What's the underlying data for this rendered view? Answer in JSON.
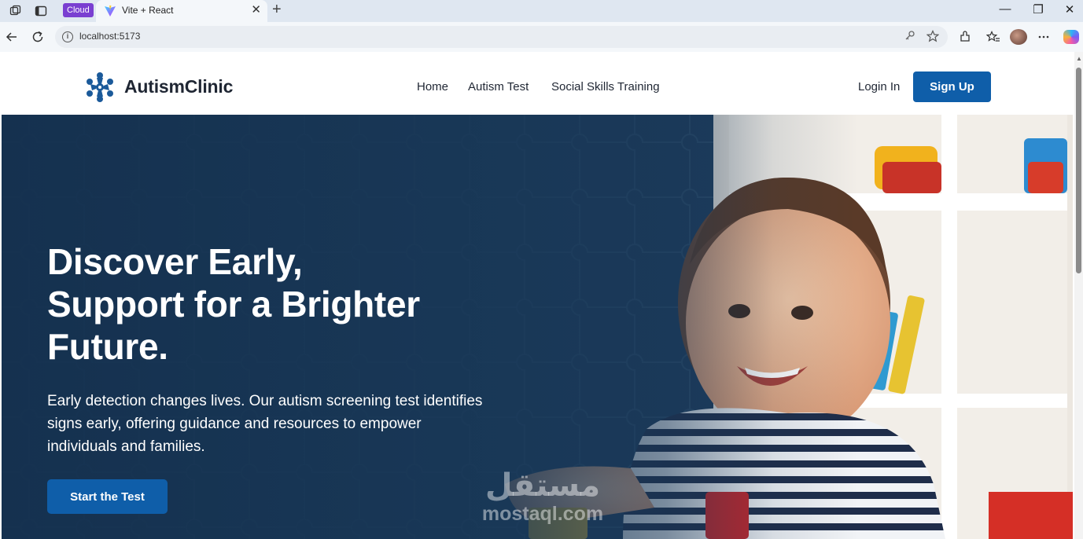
{
  "browser": {
    "badge": "Cloud",
    "tab_title": "Vite + React",
    "tab_close": "✕",
    "new_tab": "+",
    "url": "localhost:5173",
    "window_controls": {
      "minimize": "—",
      "restore": "❐",
      "close": "✕"
    }
  },
  "site": {
    "brand": "AutismClinic",
    "brand_color": "#0f5ea9",
    "nav": {
      "home": "Home",
      "test": "Autism Test",
      "training": "Social Skills Training"
    },
    "login": "Login In",
    "signup": "Sign Up"
  },
  "hero": {
    "headline_1": "Discover Early,",
    "headline_2": "Support for a Brighter",
    "headline_3": "Future.",
    "subtext_1": "Early detection changes lives. Our autism screening test identifies",
    "subtext_2": "signs early, offering guidance and resources to empower",
    "subtext_3": "individuals and families.",
    "cta": "Start the Test",
    "image": "smiling-baby-playing-with-blocks"
  },
  "watermark": {
    "arabic": "مستقل",
    "latin": "mostaql.com"
  }
}
